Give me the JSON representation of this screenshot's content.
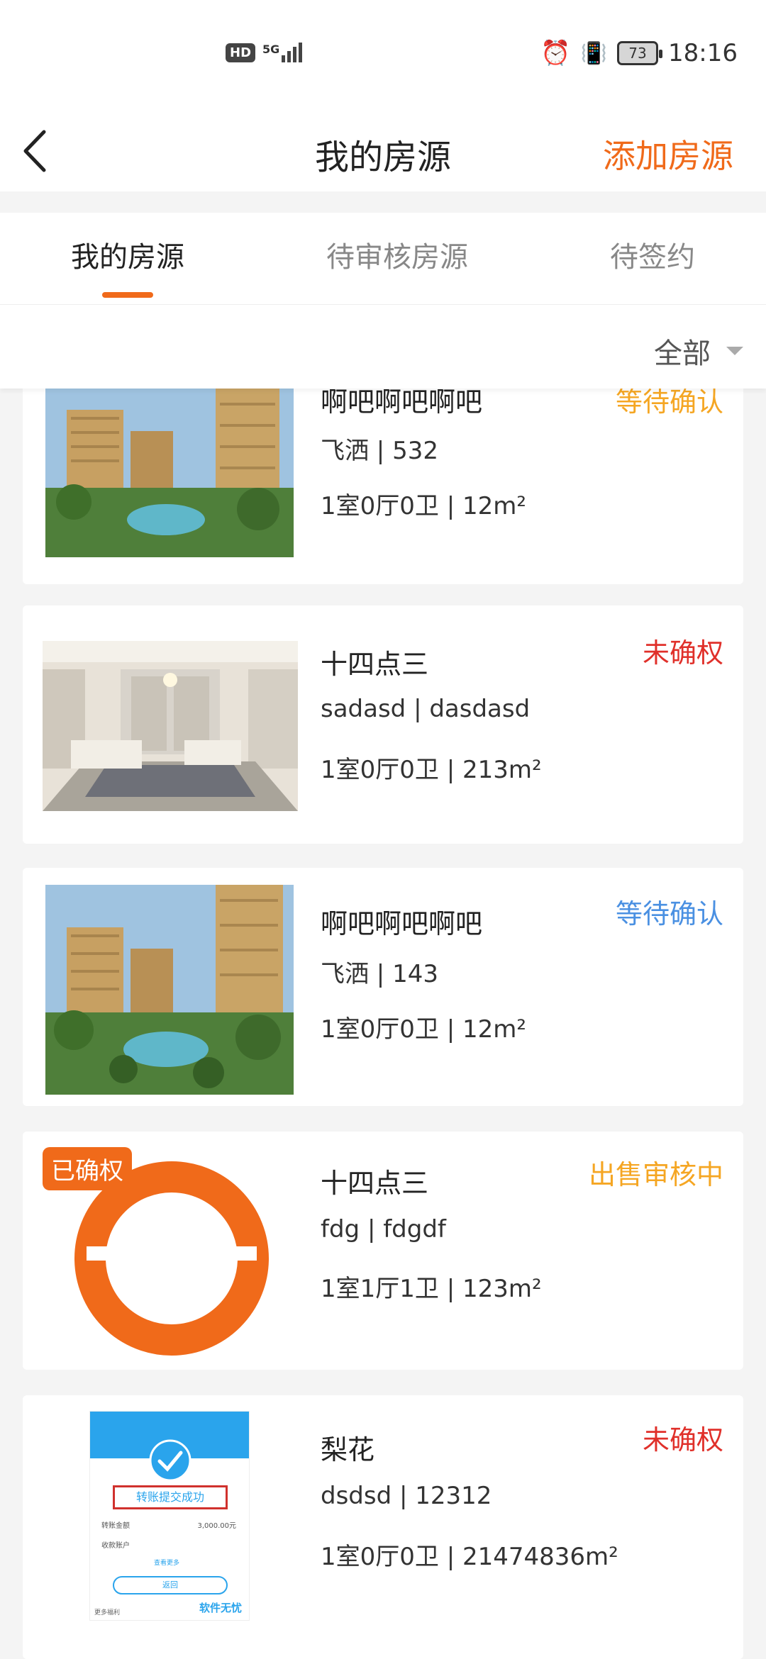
{
  "status_bar": {
    "left_badge": "HD",
    "signal_label": "5G",
    "battery": "73",
    "time": "18:16"
  },
  "header": {
    "title": "我的房源",
    "action_label": "添加房源"
  },
  "tabs": [
    {
      "label": "我的房源",
      "active": true
    },
    {
      "label": "待审核房源",
      "active": false
    },
    {
      "label": "待签约",
      "active": false
    }
  ],
  "filter": {
    "selected": "全部"
  },
  "colors": {
    "accent": "#f06a1a",
    "status_red": "#e0302a",
    "status_blue": "#4a90e2",
    "status_orange": "#f5a623"
  },
  "listings": [
    {
      "title": "啊吧啊吧啊吧",
      "address": "飞洒 | 532",
      "spec": "1室0厅0卫 | 12m²",
      "status": "等待确认",
      "status_color": "#f5a623",
      "image": "building"
    },
    {
      "title": "十四点三",
      "address": "sadasd  | dasdasd",
      "spec": "1室0厅0卫 | 213m²",
      "status": "未确权",
      "status_color": "#e0302a",
      "image": "living-room"
    },
    {
      "title": "啊吧啊吧啊吧",
      "address": "飞洒 | 143",
      "spec": "1室0厅0卫 | 12m²",
      "status": "等待确认",
      "status_color": "#4a90e2",
      "image": "building"
    },
    {
      "title": "十四点三",
      "address": "fdg | fdgdf",
      "spec": "1室1厅1卫 | 123m²",
      "status": "出售审核中",
      "status_color": "#f5a623",
      "image": "logo",
      "badge": "已确权"
    },
    {
      "title": "梨花",
      "address": "dsdsd | 12312",
      "spec": "1室0厅0卫 | 21474836m²",
      "status": "未确权",
      "status_color": "#e0302a",
      "image": "receipt",
      "receipt": {
        "success_text": "转账提交成功",
        "row1_label": "转账金额",
        "row1_value": "3,000.00元",
        "row2_label": "收款账户",
        "more": "查看更多",
        "button": "返回",
        "watermark": "软件无忧",
        "footer": "更多福利"
      }
    }
  ]
}
